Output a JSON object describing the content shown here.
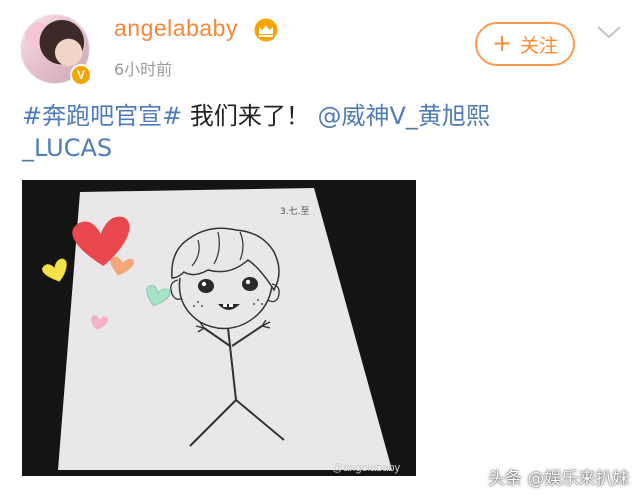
{
  "user": {
    "name": "angelababy",
    "time_ago": "6小时前",
    "verified_badge": "V"
  },
  "follow_button": {
    "plus": "+",
    "label": "关注"
  },
  "post": {
    "hashtag": "#奔跑吧官宣#",
    "text": " 我们来了！",
    "mention_line1": "@威神V_黄旭熙",
    "mention_line2": "_LUCAS"
  },
  "image": {
    "drawing_signature": "3.七.至",
    "watermark": "@angelababy"
  },
  "source_tag": "头条 @娱乐来扒妹",
  "colors": {
    "username": "#f7863a",
    "link": "#4f7cb6",
    "follow_border": "#ff9a4a",
    "verified": "#f7a400"
  },
  "icons": [
    "crown-icon",
    "chevron-down-icon",
    "verified-badge-icon"
  ]
}
